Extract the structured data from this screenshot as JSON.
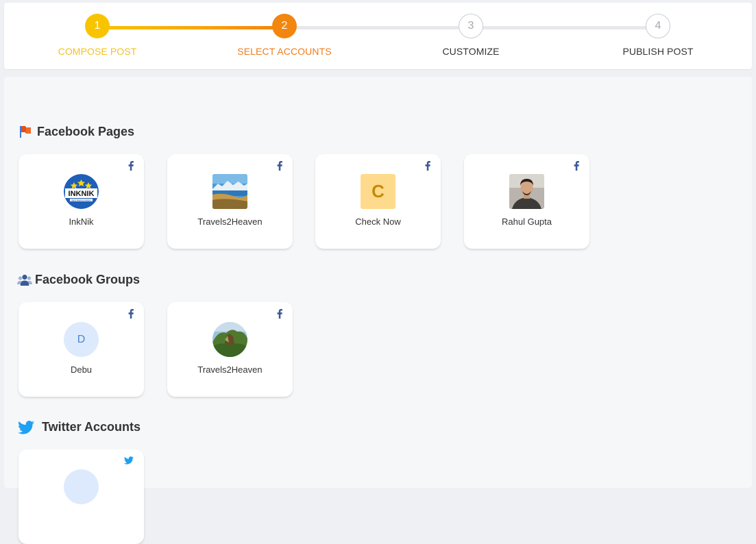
{
  "stepper": {
    "steps": [
      {
        "number": "1",
        "label": "COMPOSE POST"
      },
      {
        "number": "2",
        "label": "SELECT ACCOUNTS"
      },
      {
        "number": "3",
        "label": "CUSTOMIZE"
      },
      {
        "number": "4",
        "label": "PUBLISH POST"
      }
    ]
  },
  "sections": {
    "fb_pages": {
      "title": "Facebook Pages",
      "items": [
        {
          "name": "InkNik",
          "logo_text": "INKNIK",
          "logo_tagline": "Best Buying Guides"
        },
        {
          "name": "Travels2Heaven"
        },
        {
          "name": "Check Now",
          "initial": "C"
        },
        {
          "name": "Rahul Gupta"
        }
      ]
    },
    "fb_groups": {
      "title": "Facebook Groups",
      "items": [
        {
          "name": "Debu",
          "initial": "D"
        },
        {
          "name": "Travels2Heaven"
        }
      ]
    },
    "twitter": {
      "title": "Twitter Accounts",
      "items": [
        {
          "name": ""
        }
      ]
    }
  },
  "colors": {
    "step_done": "#f8c400",
    "step_active": "#f2860f",
    "facebook": "#3b5998",
    "twitter": "#1da1f2"
  }
}
